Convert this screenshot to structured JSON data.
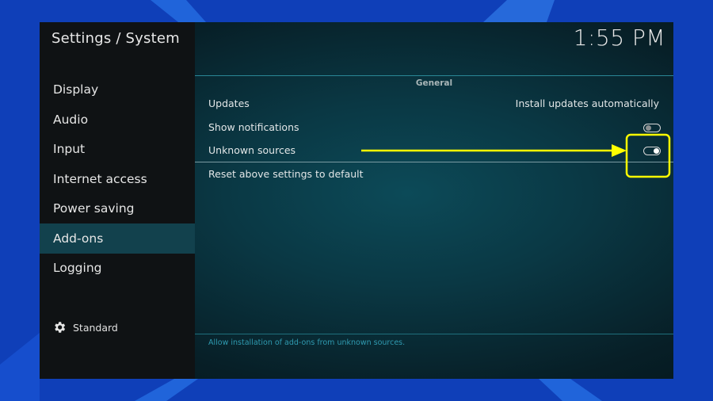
{
  "header": {
    "title": "Settings / System",
    "clock": "1:55 PM"
  },
  "sidebar": {
    "items": [
      {
        "label": "Display"
      },
      {
        "label": "Audio"
      },
      {
        "label": "Input"
      },
      {
        "label": "Internet access"
      },
      {
        "label": "Power saving"
      },
      {
        "label": "Add-ons"
      },
      {
        "label": "Logging"
      }
    ],
    "selected": "Add-ons",
    "settings_level": "Standard"
  },
  "main": {
    "group_label": "General",
    "settings": [
      {
        "label": "Updates",
        "value": "Install updates automatically"
      },
      {
        "label": "Show notifications",
        "toggle": "off"
      },
      {
        "label": "Unknown sources",
        "toggle": "on"
      },
      {
        "label": "Reset above settings to default"
      }
    ],
    "help_text": "Allow installation of add-ons from unknown sources."
  },
  "colors": {
    "frame_blue": "#0f3fb8",
    "selected_bg": "#12414d",
    "annotation_yellow": "#ffff00"
  }
}
